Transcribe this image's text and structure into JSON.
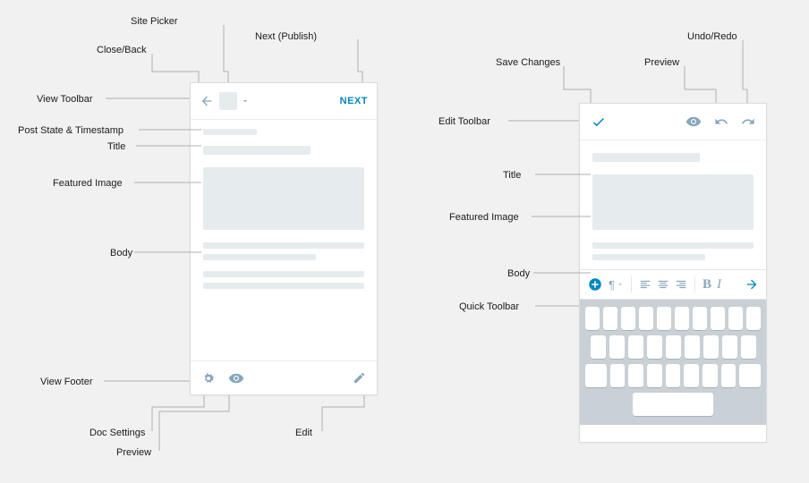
{
  "labels": {
    "site_picker": "Site Picker",
    "close_back": "Close/Back",
    "next_publish": "Next (Publish)",
    "view_toolbar": "View Toolbar",
    "post_state": "Post State & Timestamp",
    "title": "Title",
    "featured_image": "Featured Image",
    "body": "Body",
    "view_footer": "View Footer",
    "doc_settings": "Doc Settings",
    "preview": "Preview",
    "edit": "Edit",
    "save_changes": "Save Changes",
    "preview2": "Preview",
    "undo_redo": "Undo/Redo",
    "edit_toolbar": "Edit Toolbar",
    "title2": "Title",
    "featured_image2": "Featured Image",
    "body2": "Body",
    "quick_toolbar": "Quick Toolbar"
  },
  "view": {
    "next_label": "NEXT"
  },
  "quick_toolbar": {
    "paragraph": "¶",
    "bold": "B",
    "italic": "I"
  }
}
